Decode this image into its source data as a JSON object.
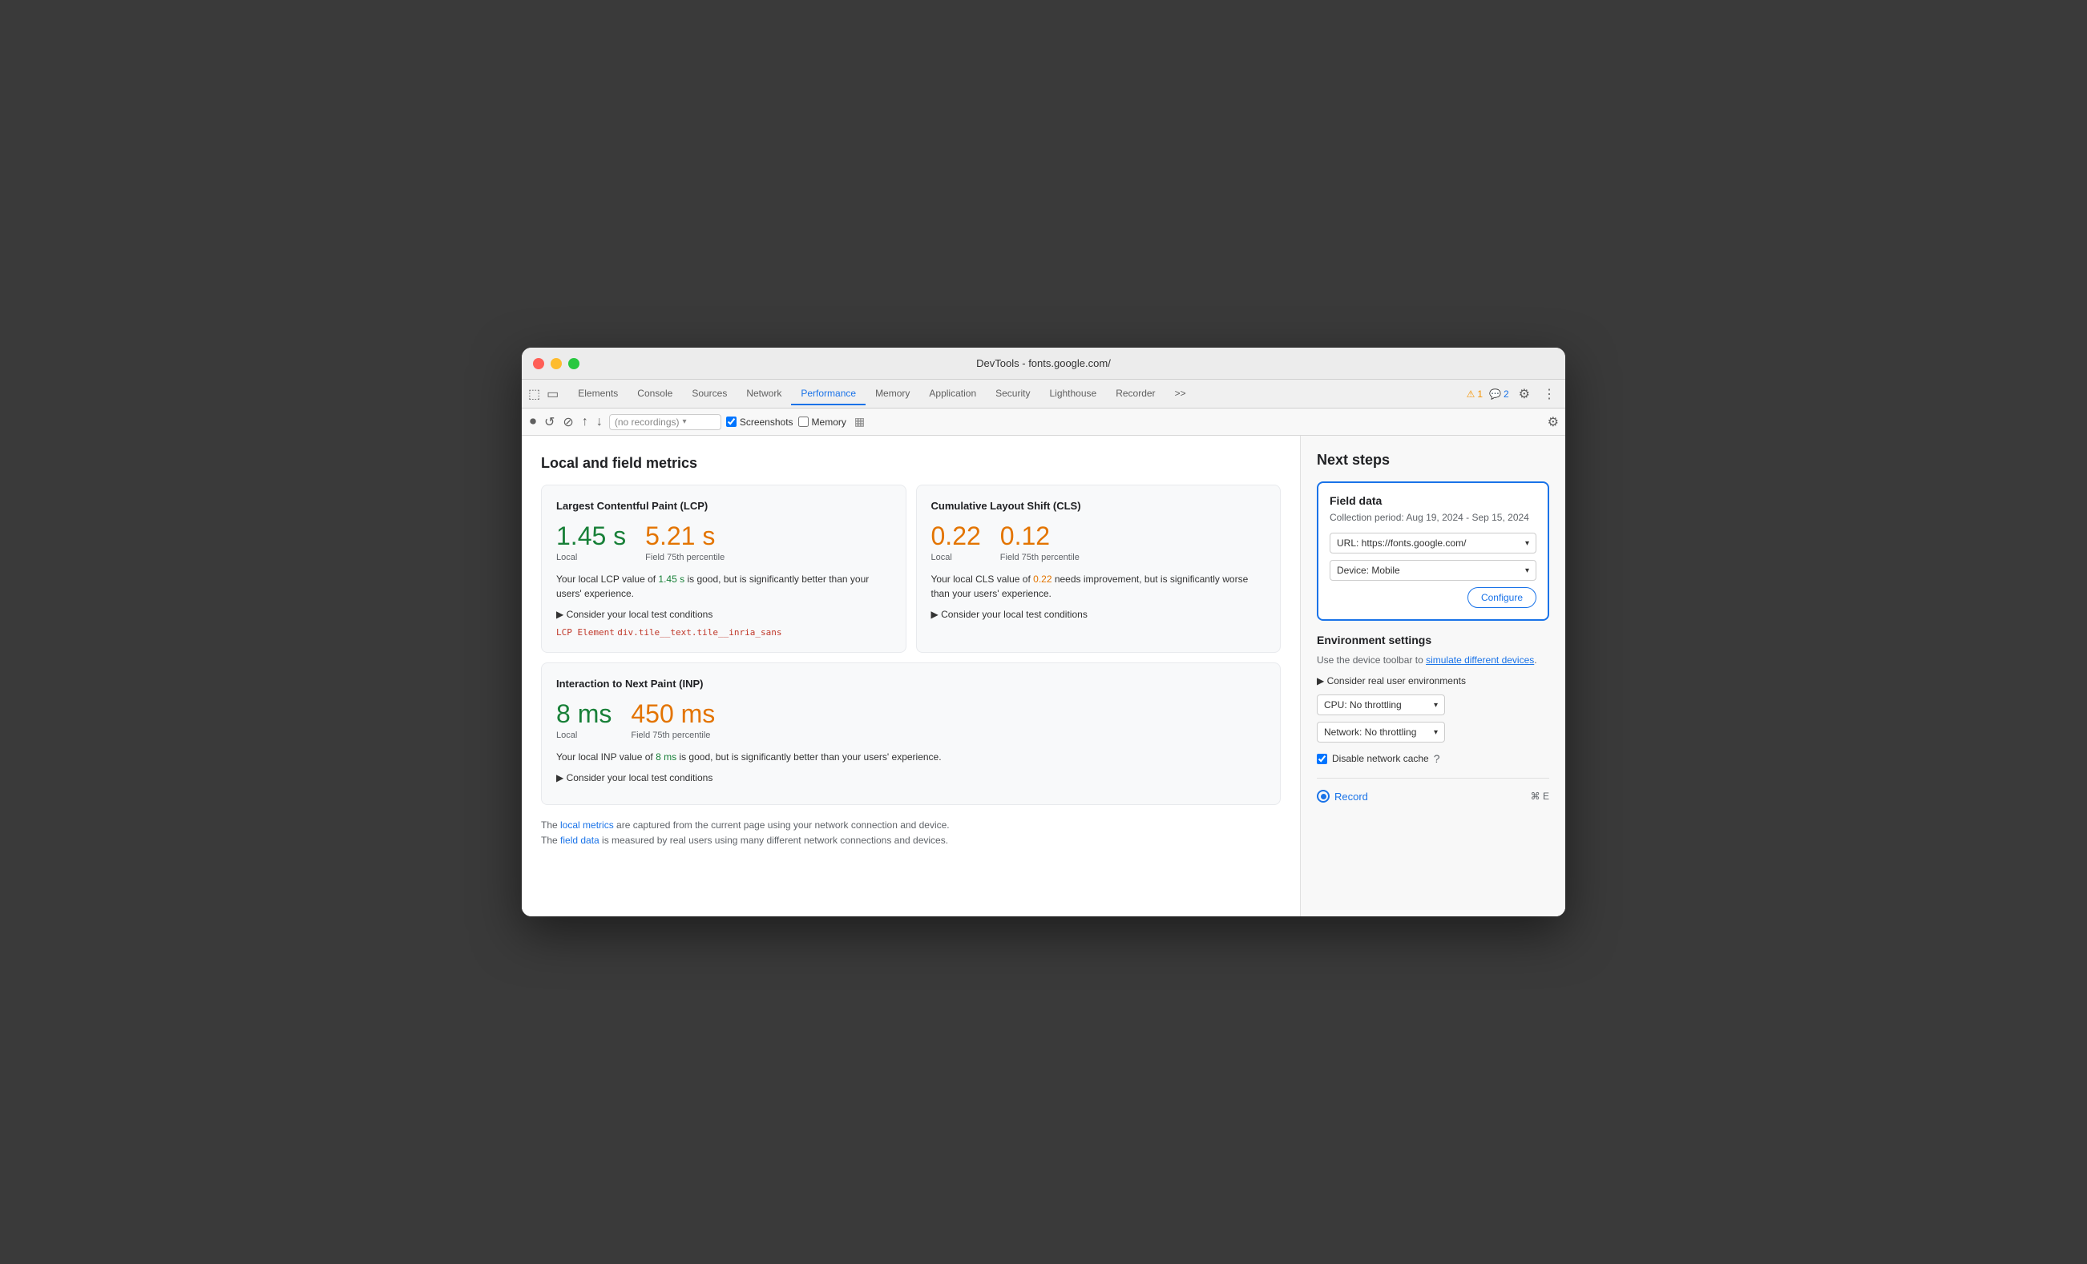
{
  "window": {
    "title": "DevTools - fonts.google.com/"
  },
  "tabs": [
    {
      "label": "Elements",
      "active": false
    },
    {
      "label": "Console",
      "active": false
    },
    {
      "label": "Sources",
      "active": false
    },
    {
      "label": "Network",
      "active": false
    },
    {
      "label": "Performance",
      "active": true
    },
    {
      "label": "Memory",
      "active": false
    },
    {
      "label": "Application",
      "active": false
    },
    {
      "label": "Security",
      "active": false
    },
    {
      "label": "Lighthouse",
      "active": false
    },
    {
      "label": "Recorder",
      "active": false
    }
  ],
  "toolbar": {
    "more_tabs": ">>",
    "warning_count": "1",
    "info_count": "2"
  },
  "secondary_toolbar": {
    "recording_placeholder": "(no recordings)",
    "screenshots_label": "Screenshots",
    "screenshots_checked": true,
    "memory_label": "Memory",
    "memory_checked": false
  },
  "main": {
    "section_title": "Local and field metrics",
    "lcp_card": {
      "title": "Largest Contentful Paint (LCP)",
      "local_value": "1.45 s",
      "local_label": "Local",
      "field_value": "5.21 s",
      "field_label": "Field 75th percentile",
      "description_1": "Your local LCP value of ",
      "highlight_1": "1.45 s",
      "description_2": " is good, but is significantly better than your users' experience.",
      "consider_link": "▶ Consider your local test conditions",
      "lcp_element_label": "LCP Element",
      "lcp_element_value": "div.tile__text.tile__inria_sans"
    },
    "cls_card": {
      "title": "Cumulative Layout Shift (CLS)",
      "local_value": "0.22",
      "local_label": "Local",
      "field_value": "0.12",
      "field_label": "Field 75th percentile",
      "description_1": "Your local CLS value of ",
      "highlight_1": "0.22",
      "description_2": " needs improvement, but is significantly worse than your users' experience.",
      "consider_link": "▶ Consider your local test conditions"
    },
    "inp_card": {
      "title": "Interaction to Next Paint (INP)",
      "local_value": "8 ms",
      "local_label": "Local",
      "field_value": "450 ms",
      "field_label": "Field 75th percentile",
      "description_1": "Your local INP value of ",
      "highlight_1": "8 ms",
      "description_2": " is good, but is significantly better than your users' experience.",
      "consider_link": "▶ Consider your local test conditions"
    },
    "footer": {
      "text_1": "The ",
      "local_link": "local metrics",
      "text_2": " are captured from the current page using your network connection and device.",
      "newline": "",
      "text_3": "The ",
      "field_link": "field data",
      "text_4": " is measured by real users using many different network connections and devices."
    }
  },
  "right_panel": {
    "title": "Next steps",
    "field_data": {
      "title": "Field data",
      "period": "Collection period: Aug 19, 2024 - Sep 15, 2024",
      "url_label": "URL: https://fonts.google.com/",
      "device_label": "Device: Mobile",
      "configure_label": "Configure"
    },
    "env_settings": {
      "title": "Environment settings",
      "desc_1": "Use the device toolbar to ",
      "link_text": "simulate different devices",
      "desc_2": ".",
      "consider_label": "▶ Consider real user environments",
      "cpu_label": "CPU: No throttling",
      "network_label": "Network: No throttling",
      "disable_cache_label": "Disable network cache"
    },
    "record": {
      "button_label": "Record",
      "shortcut": "⌘ E"
    }
  }
}
